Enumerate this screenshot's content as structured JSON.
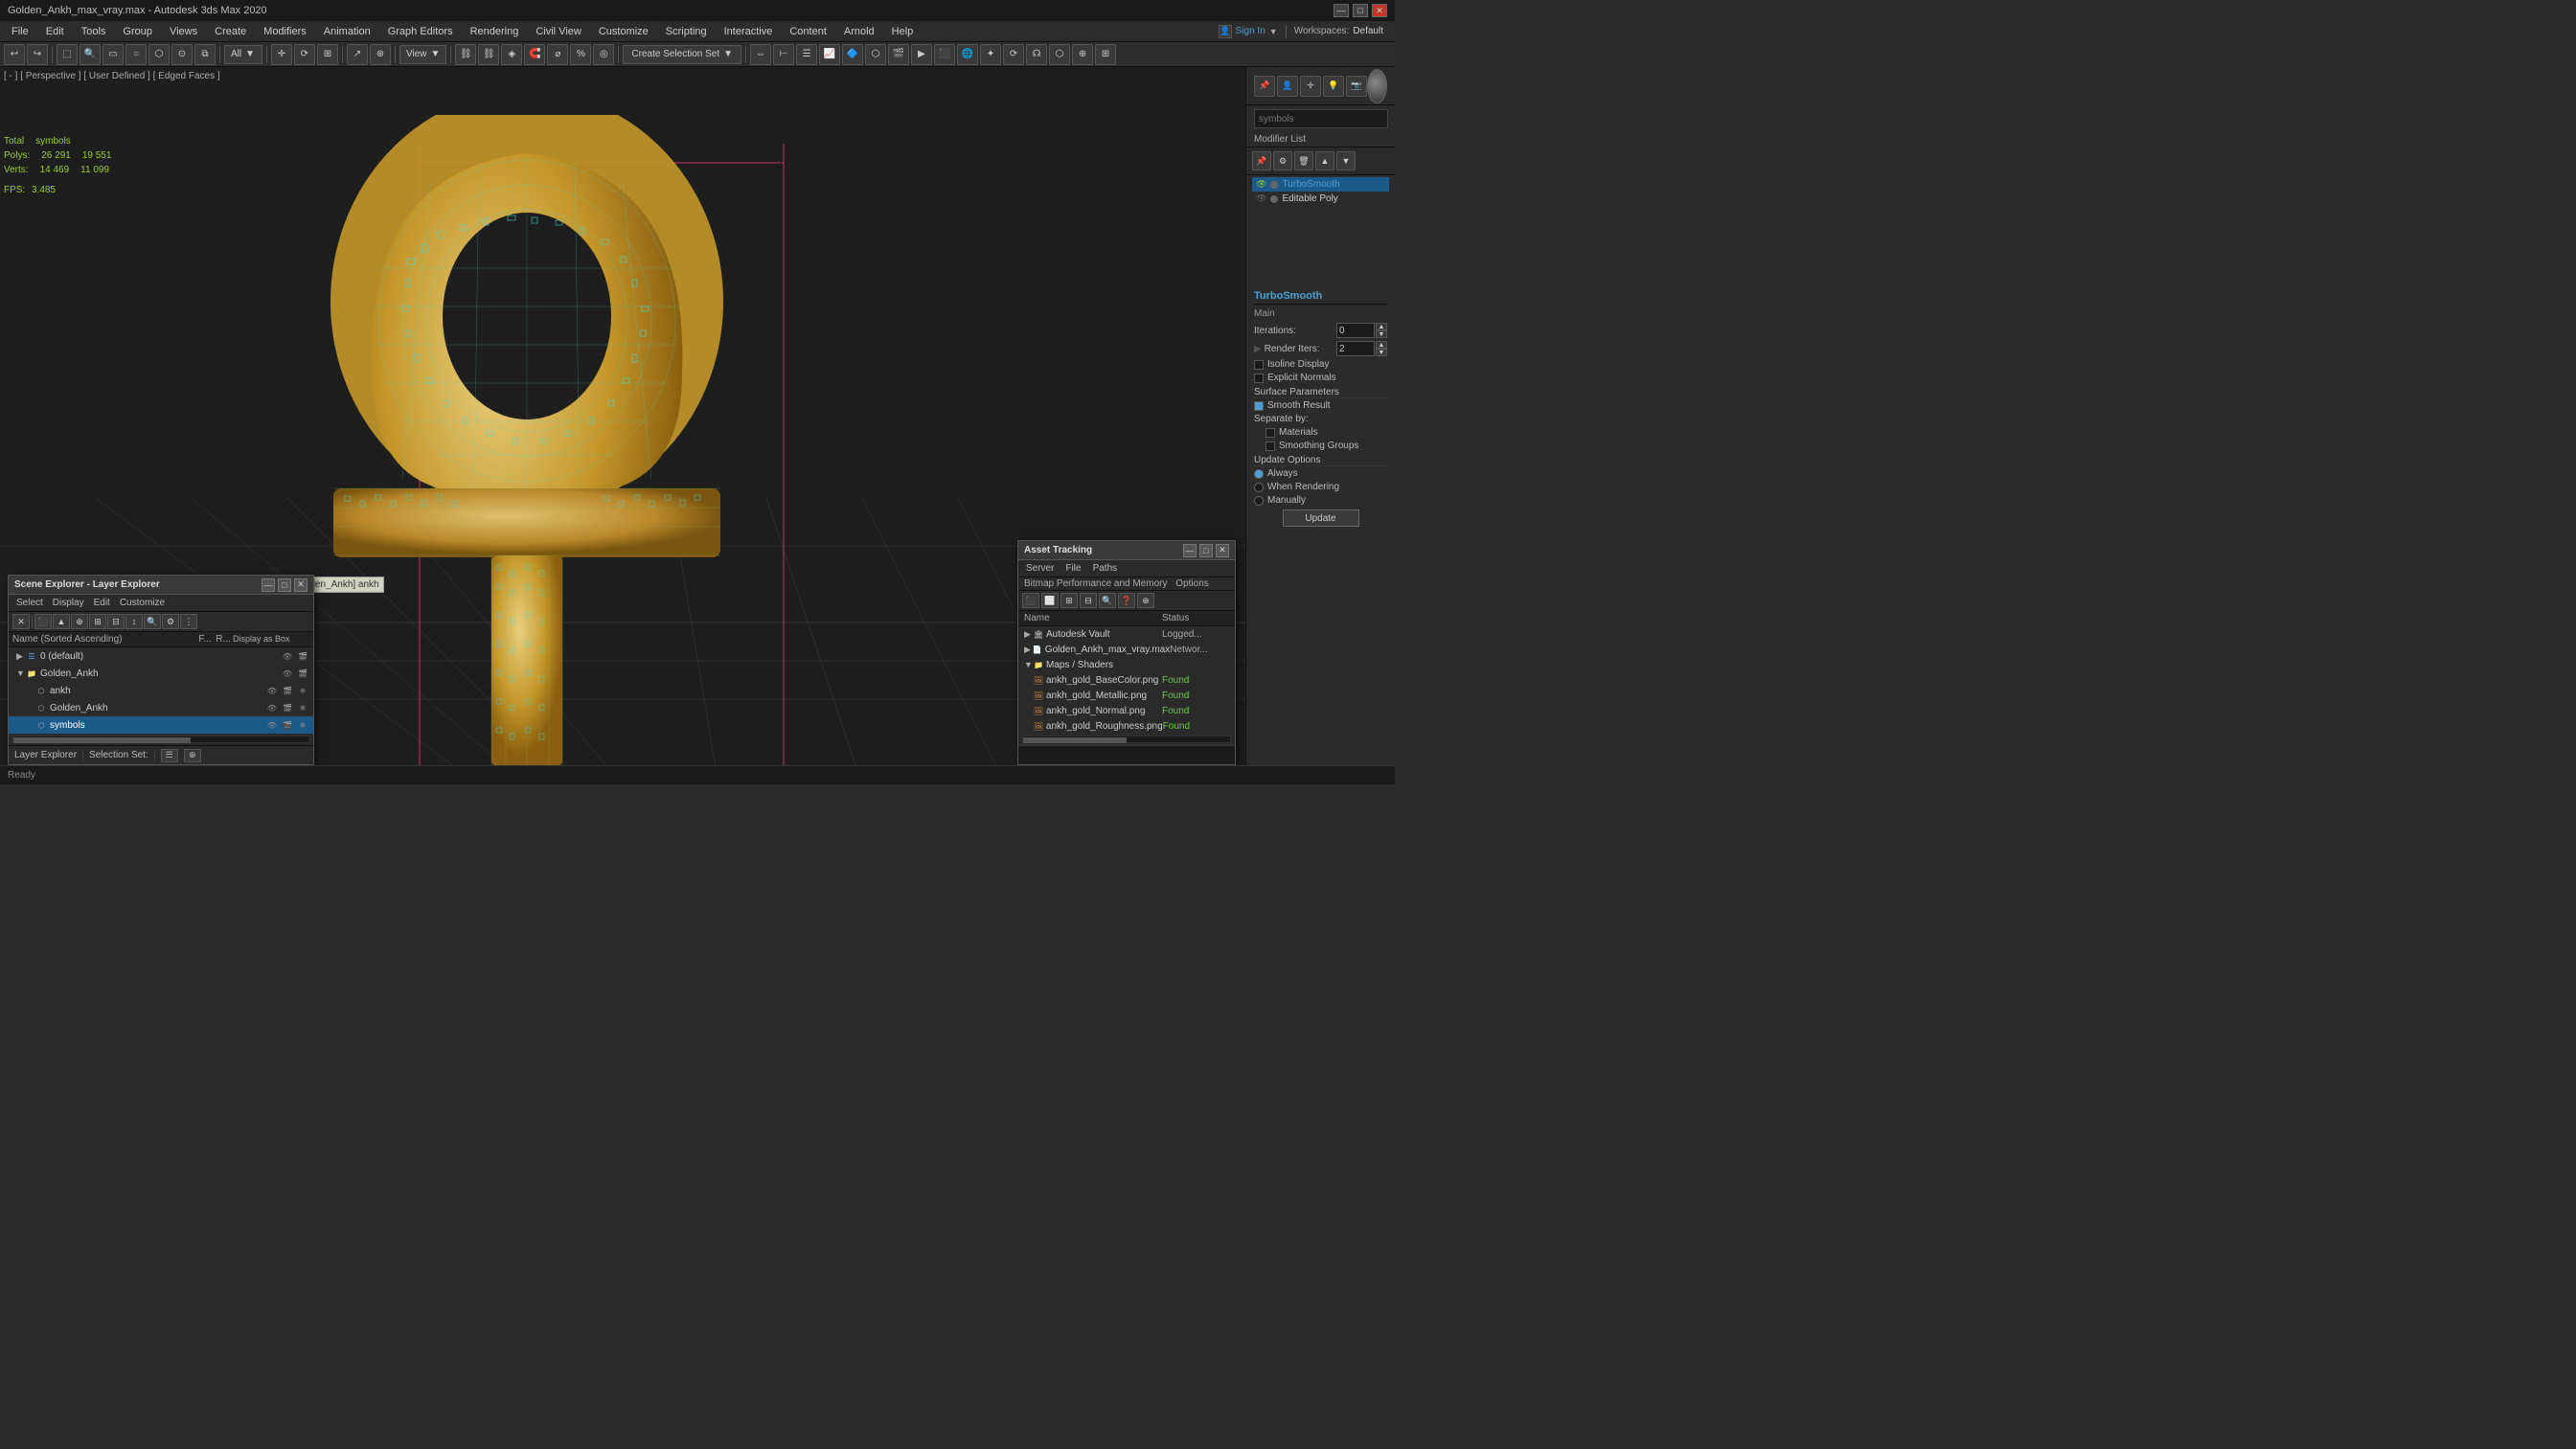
{
  "titlebar": {
    "title": "Golden_Ankh_max_vray.max - Autodesk 3ds Max 2020",
    "minimize": "—",
    "maximize": "□",
    "close": "✕"
  },
  "menubar": {
    "items": [
      "File",
      "Edit",
      "Tools",
      "Group",
      "Views",
      "Create",
      "Modifiers",
      "Animation",
      "Graph Editors",
      "Rendering",
      "Civil View",
      "Customize",
      "Scripting",
      "Interactive",
      "Content",
      "Arnold",
      "Help"
    ]
  },
  "toolbar": {
    "create_selection_set": "Create Selection Set",
    "all_dropdown": "All",
    "view_dropdown": "View"
  },
  "viewport": {
    "label": "[ - ] [ Perspective ] [ User Defined ] [ Edged Faces ]",
    "object_label": "[Golden_Ankh] ankh",
    "stats_total": "Total",
    "stats_symbols": "symbols",
    "polys_label": "Polys:",
    "polys_total": "26 291",
    "polys_symbols": "19 551",
    "verts_label": "Verts:",
    "verts_total": "14 469",
    "verts_symbols": "11 099",
    "fps_label": "FPS:",
    "fps_value": "3.485"
  },
  "right_panel": {
    "search_placeholder": "symbols",
    "modifier_list_label": "Modifier List",
    "turbosmooth_label": "TurboSmooth",
    "editable_poly_label": "Editable Poly",
    "ts_section": "TurboSmooth",
    "ts_main": "Main",
    "ts_iterations_label": "Iterations:",
    "ts_iterations_value": "0",
    "ts_render_iters_label": "Render Iters:",
    "ts_render_iters_value": "2",
    "ts_isoline_label": "Isoline Display",
    "ts_explicit_label": "Explicit Normals",
    "ts_surface_label": "Surface Parameters",
    "ts_smooth_label": "Smooth Result",
    "ts_sep_by_label": "Separate by:",
    "ts_materials_label": "Materials",
    "ts_smoothing_label": "Smoothing Groups",
    "ts_update_label": "Update Options",
    "ts_always_label": "Always",
    "ts_when_rendering_label": "When Rendering",
    "ts_manually_label": "Manually",
    "ts_update_btn": "Update"
  },
  "scene_explorer": {
    "title": "Scene Explorer - Layer Explorer",
    "menus": [
      "Select",
      "Display",
      "Edit",
      "Customize"
    ],
    "header_name": "Name (Sorted Ascending)",
    "header_f": "F...",
    "header_r": "R...",
    "header_display": "Display as Box",
    "rows": [
      {
        "indent": 0,
        "expand": "▶",
        "name": "0 (default)",
        "type": "layer",
        "selected": false
      },
      {
        "indent": 0,
        "expand": "▼",
        "name": "Golden_Ankh",
        "type": "folder",
        "selected": false
      },
      {
        "indent": 1,
        "expand": "",
        "name": "ankh",
        "type": "object",
        "selected": false
      },
      {
        "indent": 1,
        "expand": "",
        "name": "Golden_Ankh",
        "type": "object",
        "selected": false
      },
      {
        "indent": 1,
        "expand": "",
        "name": "symbols",
        "type": "object",
        "selected": true
      }
    ],
    "sel_set_label": "Layer Explorer",
    "sel_set_value": "Selection Set:"
  },
  "asset_tracking": {
    "title": "Asset Tracking",
    "menus": [
      "Server",
      "File",
      "Paths",
      "Bitmap Performance and Memory",
      "Options"
    ],
    "col_name": "Name",
    "col_status": "Status",
    "rows": [
      {
        "indent": 0,
        "expand": "▶",
        "name": "Autodesk Vault",
        "status": "Logged...",
        "status_class": "at-logged",
        "type": "vault"
      },
      {
        "indent": 0,
        "expand": "▶",
        "name": "Golden_Ankh_max_vray.max",
        "status": "Networ...",
        "status_class": "at-netw",
        "type": "file"
      },
      {
        "indent": 0,
        "expand": "▼",
        "name": "Maps / Shaders",
        "status": "",
        "status_class": "",
        "type": "folder"
      },
      {
        "indent": 1,
        "expand": "",
        "name": "ankh_gold_BaseColor.png",
        "status": "Found",
        "status_class": "at-found",
        "type": "image"
      },
      {
        "indent": 1,
        "expand": "",
        "name": "ankh_gold_Metallic.png",
        "status": "Found",
        "status_class": "at-found",
        "type": "image"
      },
      {
        "indent": 1,
        "expand": "",
        "name": "ankh_gold_Normal.png",
        "status": "Found",
        "status_class": "at-found",
        "type": "image"
      },
      {
        "indent": 1,
        "expand": "",
        "name": "ankh_gold_Roughness.png",
        "status": "Found",
        "status_class": "at-found",
        "type": "image"
      }
    ]
  },
  "workspaces": {
    "label": "Workspaces:",
    "value": "Default"
  },
  "sign_in": "Sign In"
}
